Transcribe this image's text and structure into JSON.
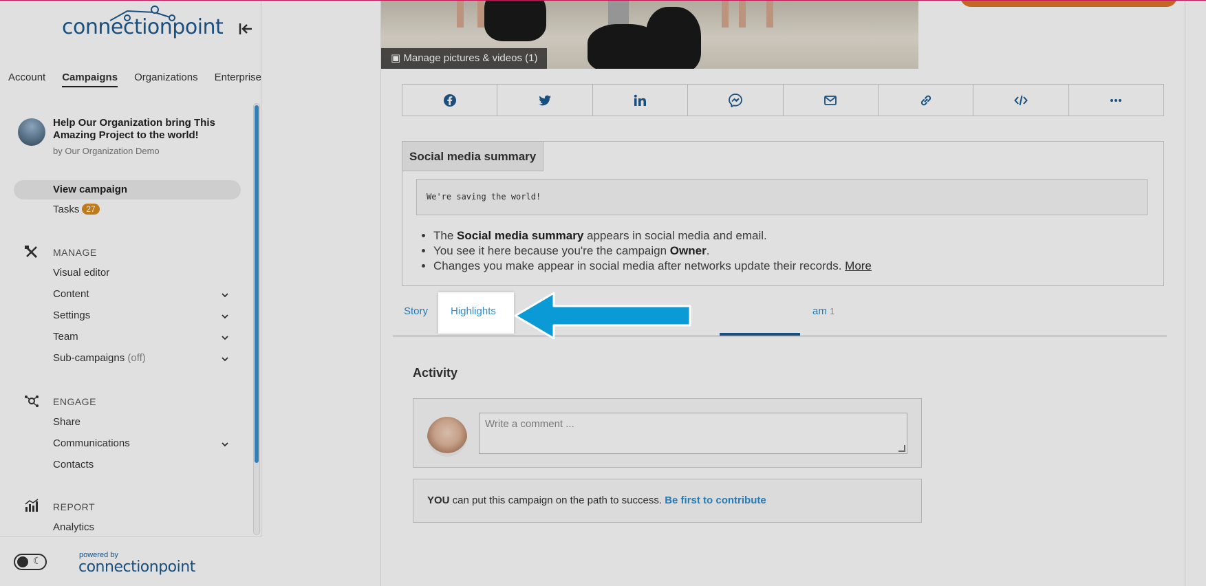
{
  "sidebar": {
    "logo": "connectionpoint",
    "top_nav": [
      "Account",
      "Campaigns",
      "Organizations",
      "Enterprise"
    ],
    "campaign": {
      "title": "Help Our Organization bring This Amazing Project to the world!",
      "by": "by Our Organization Demo"
    },
    "view_campaign": "View campaign",
    "tasks": {
      "label": "Tasks",
      "count": "27"
    },
    "manage": {
      "heading": "MANAGE",
      "items": [
        "Visual editor",
        "Content",
        "Settings",
        "Team",
        "Sub-campaigns"
      ],
      "subcampaigns_state": "(off)"
    },
    "engage": {
      "heading": "ENGAGE",
      "items": [
        "Share",
        "Communications",
        "Contacts"
      ]
    },
    "report": {
      "heading": "REPORT",
      "items": [
        "Analytics"
      ]
    },
    "footer": {
      "powered_by": "powered by",
      "logo": "connectionpoint"
    }
  },
  "main": {
    "manage_pictures": "Manage pictures & videos (1)",
    "share_icons": [
      "facebook-icon",
      "twitter-icon",
      "linkedin-icon",
      "messenger-icon",
      "email-icon",
      "link-icon",
      "embed-icon",
      "more-icon"
    ],
    "summary": {
      "tab": "Social media summary",
      "text": "We're saving the world!",
      "bullets": {
        "b1_pre": "The ",
        "b1_bold": "Social media summary",
        "b1_post": " appears in social media and email.",
        "b2_pre": "You see it here because you're the campaign ",
        "b2_bold": "Owner",
        "b2_post": ".",
        "b3_pre": "Changes you make appear in social media after networks update their records. ",
        "b3_link": "More"
      }
    },
    "tabs": {
      "story": "Story",
      "highlights": "Highlights",
      "team_tail": "am",
      "team_count": "1"
    },
    "activity": {
      "title": "Activity",
      "comment_placeholder": "Write a comment ...",
      "contribute_bold": "YOU",
      "contribute_text": " can put this campaign on the path to success. ",
      "contribute_link": "Be first to contribute"
    }
  },
  "colors": {
    "brand_dark": "#1d5b91",
    "brand_light": "#2b8ed0",
    "badge": "#d98c1f",
    "cta": "#e1762a",
    "arrow": "#0a9ad6"
  }
}
